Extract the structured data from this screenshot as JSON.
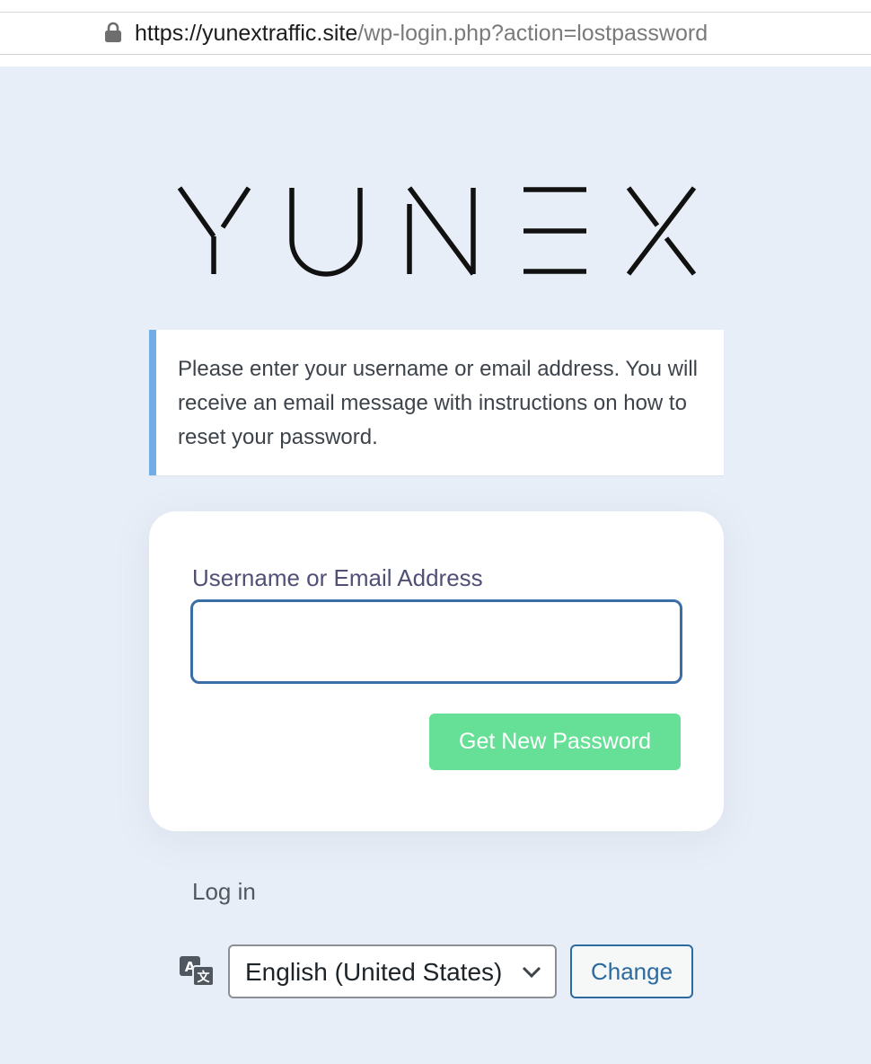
{
  "browser": {
    "url_domain": "https://yunextraffic.site",
    "url_path": "/wp-login.php?action=lostpassword"
  },
  "logo": {
    "text": "YUNEX"
  },
  "notice": {
    "message": "Please enter your username or email address. You will receive an email message with instructions on how to reset your password."
  },
  "form": {
    "field_label": "Username or Email Address",
    "field_value": "",
    "submit_label": "Get New Password"
  },
  "links": {
    "login": "Log in"
  },
  "language": {
    "selected": "English (United States)",
    "change_label": "Change"
  },
  "colors": {
    "background": "#e8eef7",
    "notice_accent": "#72aee6",
    "submit_button": "#66e096",
    "link_blue": "#2c6aa0"
  }
}
